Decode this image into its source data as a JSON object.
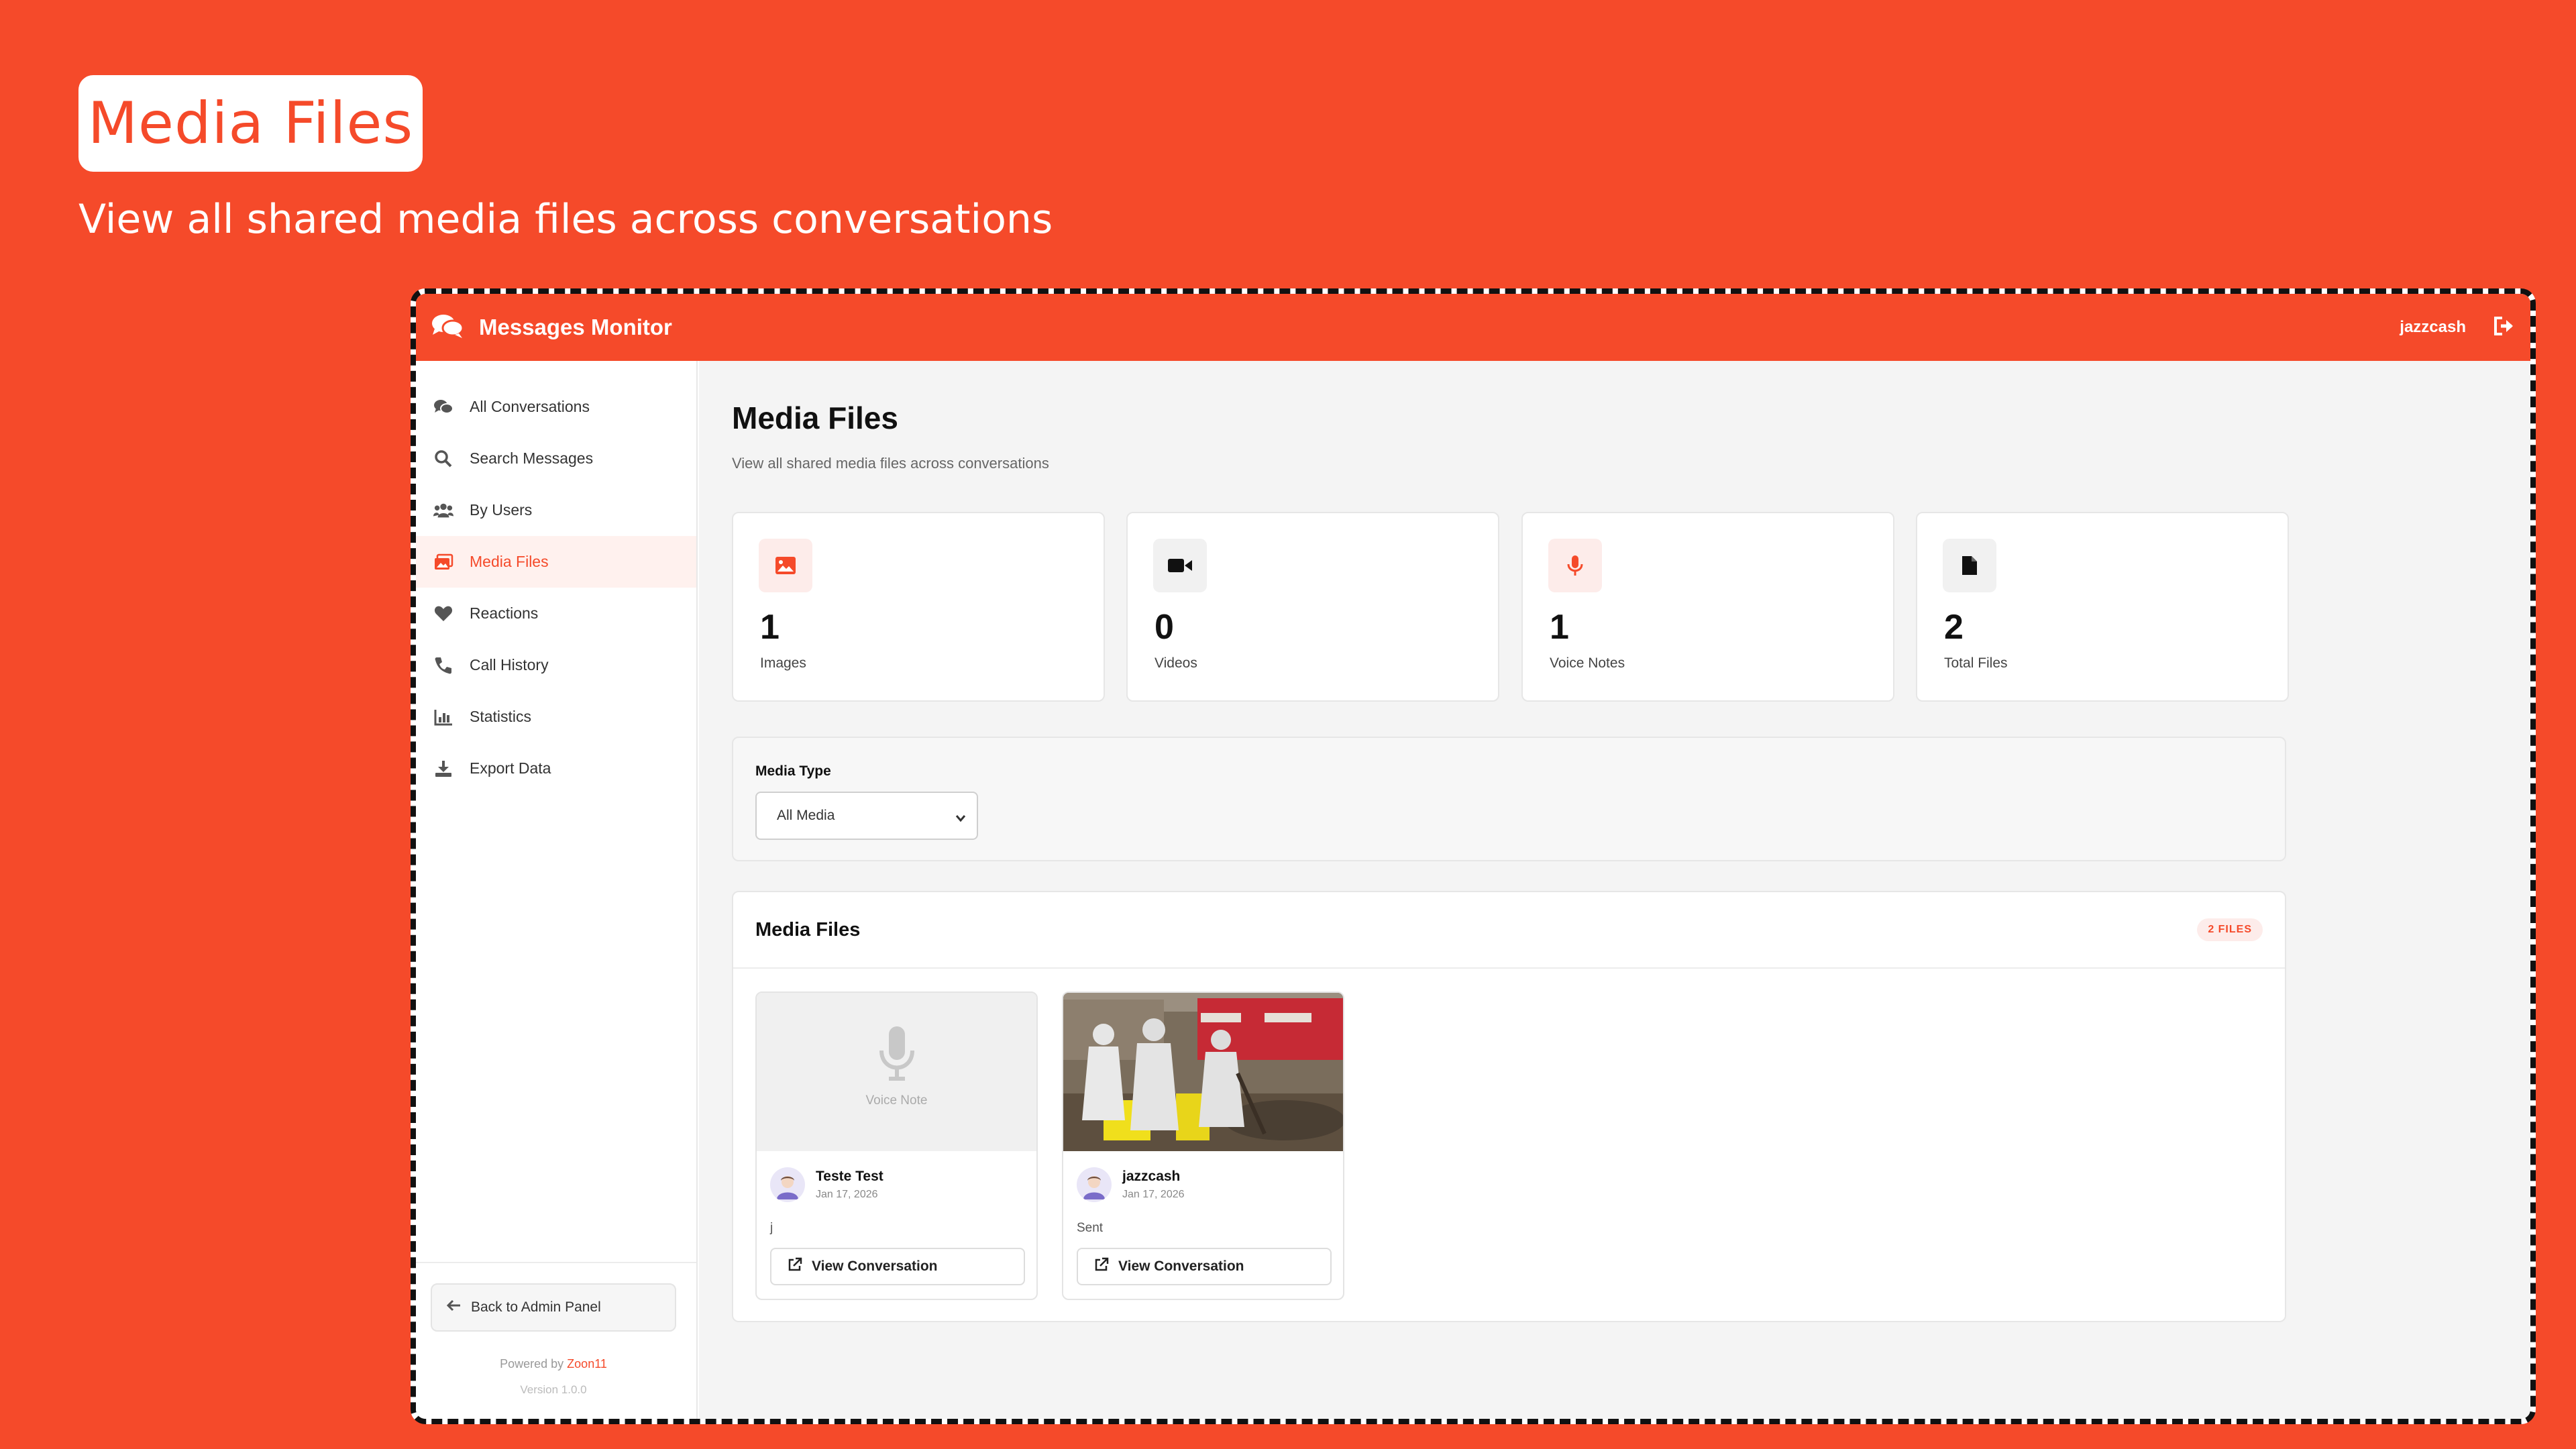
{
  "hero": {
    "title": "Media Files",
    "subtitle": "View all shared media files across conversations"
  },
  "app": {
    "brand": "Messages Monitor",
    "username": "jazzcash",
    "accent": "#f54a2a"
  },
  "sidebar": {
    "items": [
      {
        "label": "All Conversations",
        "icon": "comments-icon"
      },
      {
        "label": "Search Messages",
        "icon": "search-icon"
      },
      {
        "label": "By Users",
        "icon": "users-icon"
      },
      {
        "label": "Media Files",
        "icon": "images-icon",
        "active": true
      },
      {
        "label": "Reactions",
        "icon": "heart-icon"
      },
      {
        "label": "Call History",
        "icon": "phone-icon"
      },
      {
        "label": "Statistics",
        "icon": "chart-icon"
      },
      {
        "label": "Export Data",
        "icon": "download-icon"
      }
    ],
    "back_label": "Back to Admin Panel",
    "powered_prefix": "Powered by",
    "powered_brand": "Zoon11",
    "version": "Version 1.0.0"
  },
  "main": {
    "title": "Media Files",
    "subtitle": "View all shared media files across conversations",
    "stats": [
      {
        "value": "1",
        "label": "Images",
        "icon": "image-icon",
        "icon_color": "#f54a2a",
        "icon_bg": "#fdecea"
      },
      {
        "value": "0",
        "label": "Videos",
        "icon": "video-icon",
        "icon_color": "#111111",
        "icon_bg": "#f1f1f1"
      },
      {
        "value": "1",
        "label": "Voice Notes",
        "icon": "microphone-icon",
        "icon_color": "#f54a2a",
        "icon_bg": "#fdecea"
      },
      {
        "value": "2",
        "label": "Total Files",
        "icon": "file-icon",
        "icon_color": "#111111",
        "icon_bg": "#f1f1f1"
      }
    ],
    "filter": {
      "label": "Media Type",
      "selected": "All Media"
    },
    "media_panel": {
      "title": "Media Files",
      "badge": "2 FILES",
      "cards": [
        {
          "type": "voice",
          "thumb_label": "Voice Note",
          "name": "Teste Test",
          "date": "Jan 17, 2026",
          "caption": "j",
          "button": "View Conversation"
        },
        {
          "type": "image",
          "name": "jazzcash",
          "date": "Jan 17, 2026",
          "caption": "Sent",
          "button": "View Conversation"
        }
      ]
    }
  }
}
